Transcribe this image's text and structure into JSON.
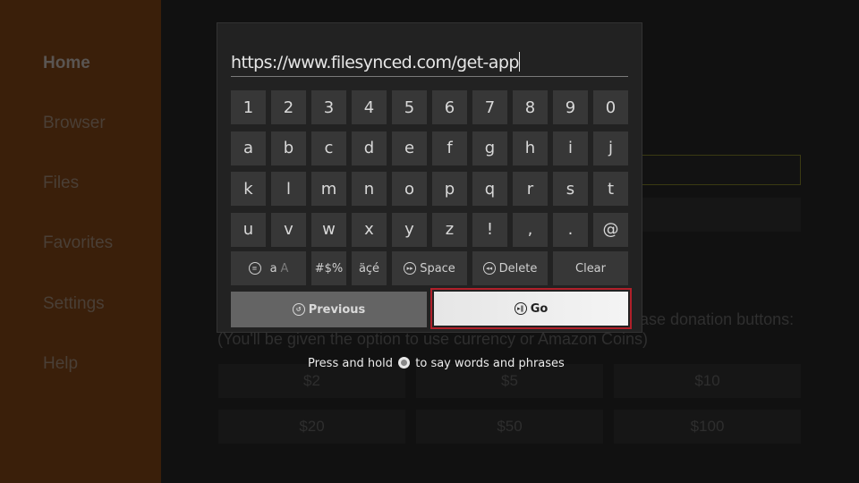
{
  "sidebar": {
    "items": [
      {
        "label": "Home",
        "active": true
      },
      {
        "label": "Browser"
      },
      {
        "label": "Files"
      },
      {
        "label": "Favorites"
      },
      {
        "label": "Settings"
      },
      {
        "label": "Help"
      }
    ]
  },
  "background": {
    "donation_prompt": "ase donation buttons:",
    "donation_note": "(You'll be given the option to use currency or Amazon Coins)",
    "donation_buttons": [
      "$2",
      "$5",
      "$10",
      "$20",
      "$50",
      "$100"
    ]
  },
  "keyboard": {
    "url_value": "https://www.filesynced.com/get-app",
    "rows": [
      [
        "1",
        "2",
        "3",
        "4",
        "5",
        "6",
        "7",
        "8",
        "9",
        "0"
      ],
      [
        "a",
        "b",
        "c",
        "d",
        "e",
        "f",
        "g",
        "h",
        "i",
        "j"
      ],
      [
        "k",
        "l",
        "m",
        "n",
        "o",
        "p",
        "q",
        "r",
        "s",
        "t"
      ],
      [
        "u",
        "v",
        "w",
        "x",
        "y",
        "z",
        "!",
        ",",
        ".",
        "@"
      ]
    ],
    "function_keys": {
      "case_small": "a",
      "case_large": "A",
      "symbols": "#$%",
      "accents": "äçé",
      "space": "Space",
      "delete": "Delete",
      "clear": "Clear"
    },
    "previous_label": "Previous",
    "go_label": "Go",
    "focus_color": "#b0202a"
  },
  "hint": {
    "before": "Press and hold ",
    "after": " to say words and phrases"
  }
}
